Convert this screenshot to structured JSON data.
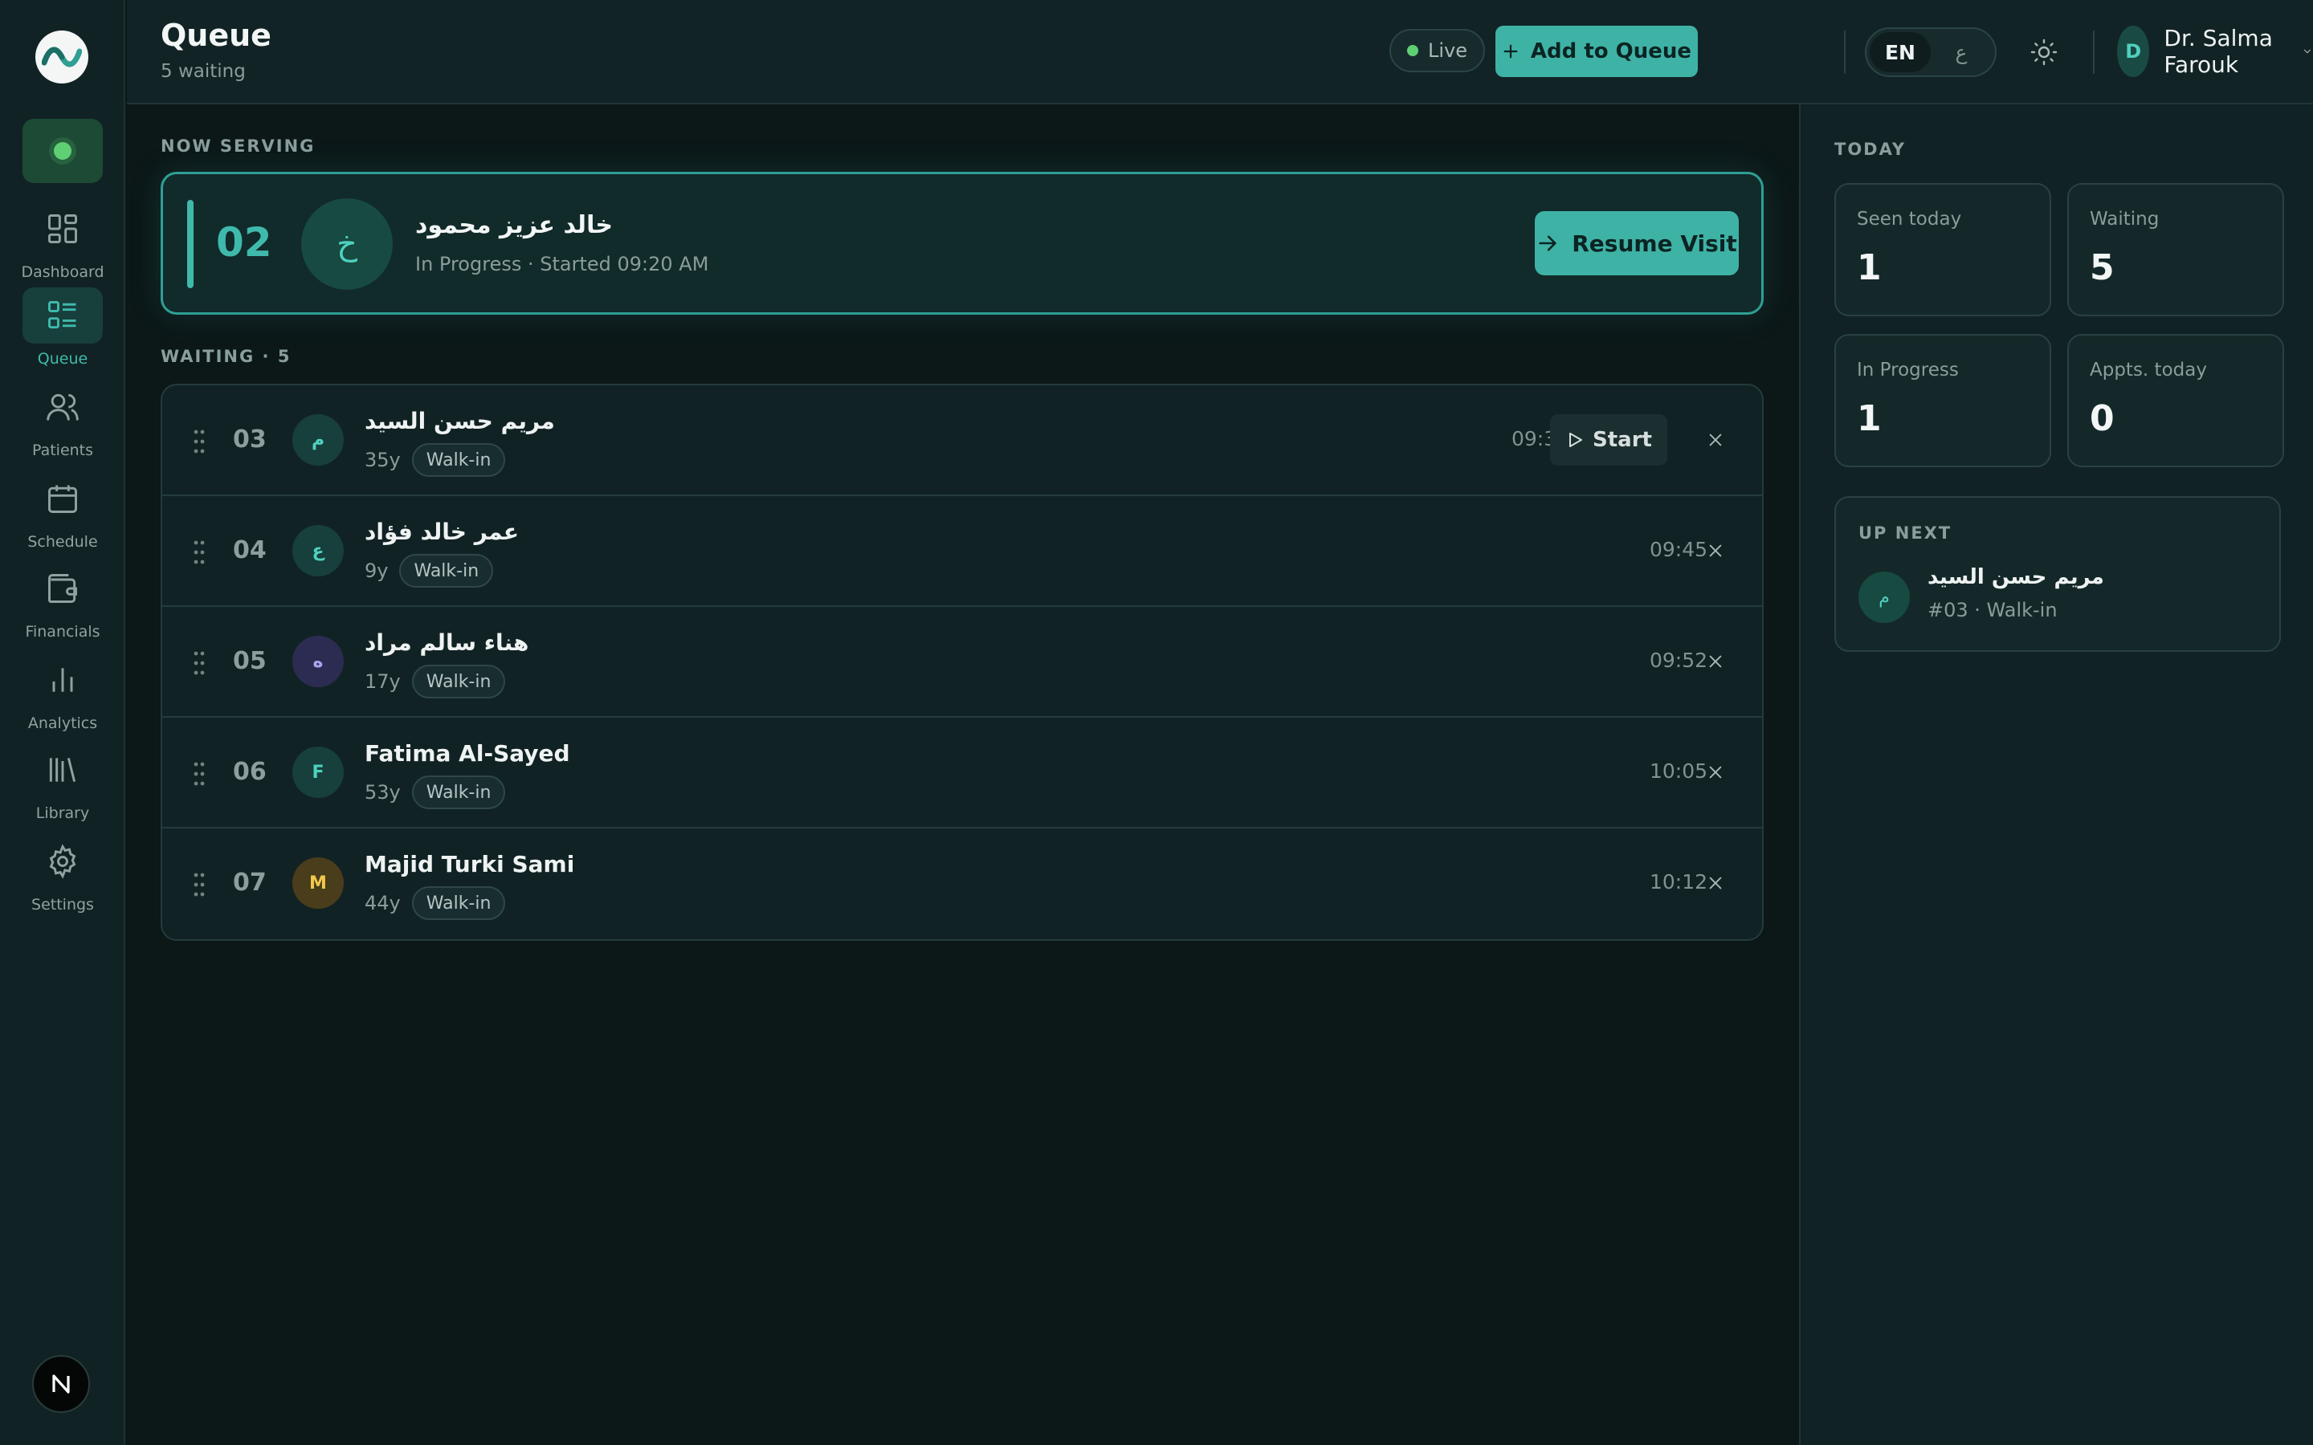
{
  "nav": {
    "items": [
      {
        "label": "Dashboard",
        "icon": "dashboard-icon"
      },
      {
        "label": "Queue",
        "icon": "queue-list-icon",
        "active": true
      },
      {
        "label": "Patients",
        "icon": "users-icon"
      },
      {
        "label": "Schedule",
        "icon": "calendar-icon"
      },
      {
        "label": "Financials",
        "icon": "wallet-icon"
      },
      {
        "label": "Analytics",
        "icon": "bar-chart-icon"
      },
      {
        "label": "Library",
        "icon": "library-icon"
      },
      {
        "label": "Settings",
        "icon": "gear-icon"
      }
    ]
  },
  "header": {
    "title": "Queue",
    "subtitle": "5 waiting",
    "live_label": "Live",
    "add_button": "Add to Queue",
    "lang_en": "EN",
    "lang_ar": "ع",
    "user_initial": "D",
    "user_name": "Dr. Salma Farouk"
  },
  "now_serving": {
    "section_label": "NOW SERVING",
    "number": "02",
    "initial": "خ",
    "name": "خالد عزيز محمود",
    "status": "In Progress · Started 09:20 AM",
    "action": "Resume Visit"
  },
  "waiting": {
    "section_label": "WAITING · 5",
    "start_label": "Start",
    "rows": [
      {
        "number": "03",
        "initial": "م",
        "name": "مريم حسن السيد",
        "age": "35y",
        "tag": "Walk-in",
        "time": "09:30",
        "avatar_bg": "#173f3c",
        "avatar_fg": "#4fd1bf"
      },
      {
        "number": "04",
        "initial": "ع",
        "name": "عمر خالد فؤاد",
        "age": "9y",
        "tag": "Walk-in",
        "time": "09:45",
        "avatar_bg": "#173f3c",
        "avatar_fg": "#4fd1bf"
      },
      {
        "number": "05",
        "initial": "ه",
        "name": "هناء سالم مراد",
        "age": "17y",
        "tag": "Walk-in",
        "time": "09:52",
        "avatar_bg": "#2c2c52",
        "avatar_fg": "#a7a3f0"
      },
      {
        "number": "06",
        "initial": "F",
        "name": "Fatima Al-Sayed",
        "age": "53y",
        "tag": "Walk-in",
        "time": "10:05",
        "avatar_bg": "#173f3c",
        "avatar_fg": "#4fd1bf"
      },
      {
        "number": "07",
        "initial": "M",
        "name": "Majid Turki Sami",
        "age": "44y",
        "tag": "Walk-in",
        "time": "10:12",
        "avatar_bg": "#4a3d1c",
        "avatar_fg": "#f2c94c"
      }
    ]
  },
  "today": {
    "section_label": "TODAY",
    "stats": [
      {
        "label": "Seen today",
        "value": "1"
      },
      {
        "label": "Waiting",
        "value": "5"
      },
      {
        "label": "In Progress",
        "value": "1"
      },
      {
        "label": "Appts. today",
        "value": "0"
      }
    ]
  },
  "up_next": {
    "section_label": "UP NEXT",
    "initial": "م",
    "name": "مريم حسن السيد",
    "meta": "#03 · Walk-in"
  },
  "colors": {
    "accent": "#3fb2a6",
    "live": "#5fcf73",
    "background": "#0c1718"
  }
}
